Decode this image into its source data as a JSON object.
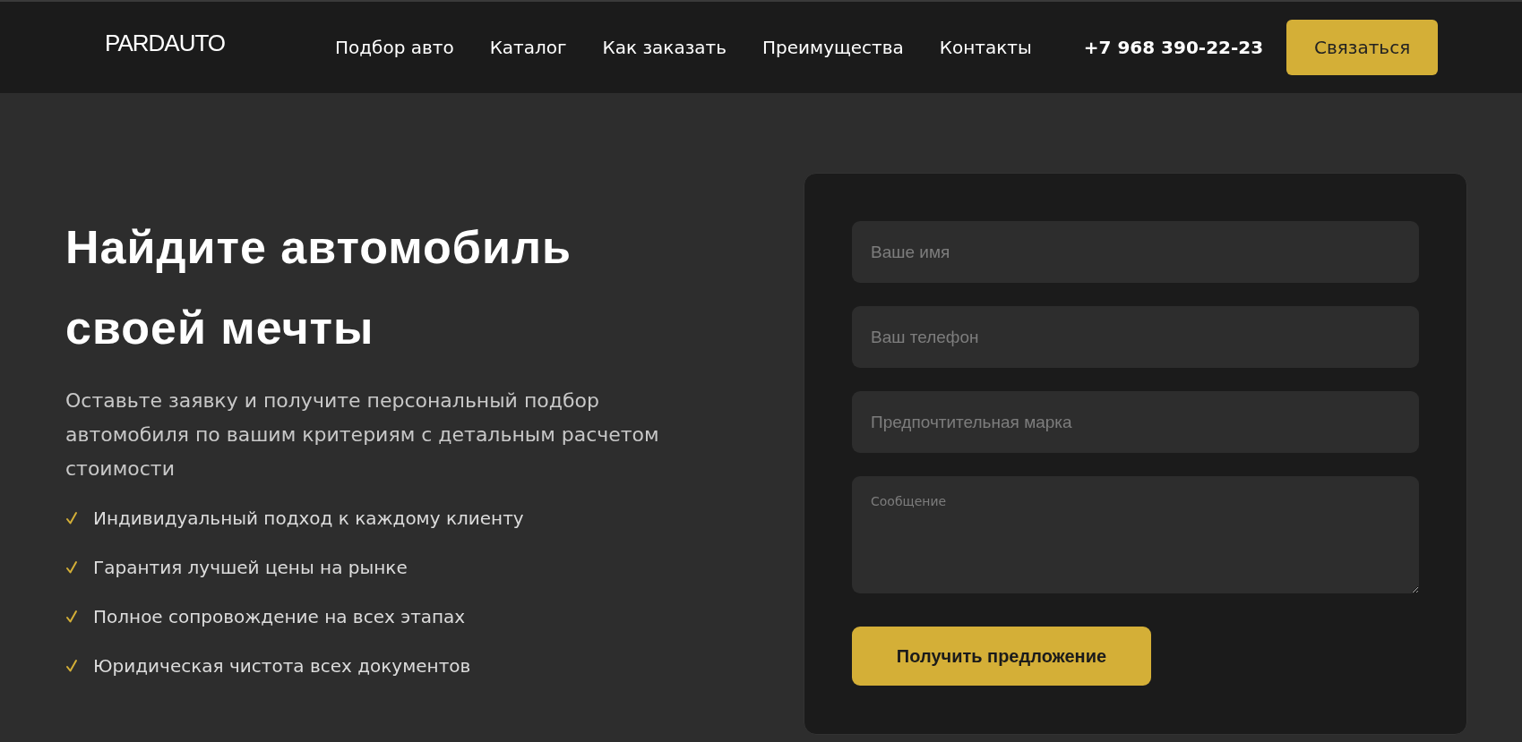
{
  "header": {
    "logo": "PARDAUTO",
    "nav": [
      "Подбор авто",
      "Каталог",
      "Как заказать",
      "Преимущества",
      "Контакты"
    ],
    "phone": "+7 968 390-22-23",
    "cta": "Связаться"
  },
  "hero": {
    "title_lines": [
      "Найдите автомобиль",
      "своей мечты"
    ],
    "subtitle": "Оставьте заявку и получите персональный подбор автомобиля по вашим критериям с детальным расчетом стоимости",
    "features": [
      "Индивидуальный подход к каждому клиенту",
      "Гарантия лучшей цены на рынке",
      "Полное сопровождение на всех этапах",
      "Юридическая чистота всех документов"
    ]
  },
  "form": {
    "fields": [
      {
        "kind": "input",
        "placeholder": "Ваше имя"
      },
      {
        "kind": "input",
        "placeholder": "Ваш телефон"
      },
      {
        "kind": "input",
        "placeholder": "Предпочтительная марка"
      },
      {
        "kind": "textarea",
        "placeholder": "Сообщение"
      }
    ],
    "submit": "Получить предложение"
  }
}
